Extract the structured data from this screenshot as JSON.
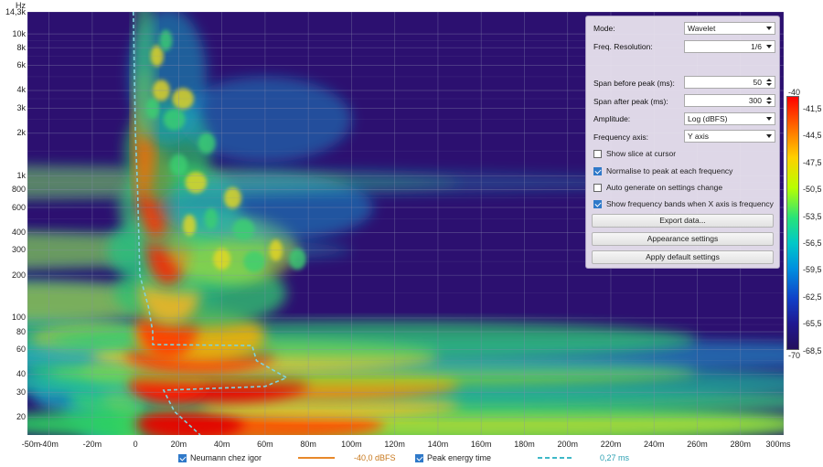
{
  "chart_data": {
    "type": "heatmap",
    "yunit": "Hz",
    "yticks": [
      "14,3k",
      "10k",
      "8k",
      "6k",
      "4k",
      "3k",
      "2k",
      "1k",
      "800",
      "600",
      "400",
      "300",
      "200",
      "100",
      "80",
      "60",
      "40",
      "30",
      "20"
    ],
    "xticks": [
      "-50m",
      "-40m",
      "-20m",
      "0",
      "20m",
      "40m",
      "60m",
      "80m",
      "100m",
      "120m",
      "140m",
      "160m",
      "180m",
      "200m",
      "220m",
      "240m",
      "260m",
      "280m",
      "300ms"
    ],
    "colorbar_ticks": [
      "-40",
      "-41,5",
      "-44,5",
      "-47,5",
      "-50,5",
      "-53,5",
      "-56,5",
      "-59,5",
      "-62,5",
      "-65,5",
      "-68,5",
      "-70"
    ],
    "xlim_ms": [
      -50,
      300
    ],
    "ylim_hz": [
      15,
      14300
    ],
    "yscale": "log",
    "zlim_dbfs": [
      -70,
      -40
    ],
    "peak_energy_curve": [
      {
        "t_ms": -1,
        "f_hz": 14300
      },
      {
        "t_ms": -0.5,
        "f_hz": 5000
      },
      {
        "t_ms": 0,
        "f_hz": 2000
      },
      {
        "t_ms": 1,
        "f_hz": 800
      },
      {
        "t_ms": 2,
        "f_hz": 200
      },
      {
        "t_ms": 6,
        "f_hz": 120
      },
      {
        "t_ms": 8,
        "f_hz": 80
      },
      {
        "t_ms": 8,
        "f_hz": 65
      },
      {
        "t_ms": 54,
        "f_hz": 64
      },
      {
        "t_ms": 56,
        "f_hz": 50
      },
      {
        "t_ms": 70,
        "f_hz": 38
      },
      {
        "t_ms": 60,
        "f_hz": 33
      },
      {
        "t_ms": 13,
        "f_hz": 31
      },
      {
        "t_ms": 18,
        "f_hz": 22
      },
      {
        "t_ms": 30,
        "f_hz": 15
      }
    ]
  },
  "panel": {
    "mode_label": "Mode:",
    "mode_value": "Wavelet",
    "freq_res_label": "Freq. Resolution:",
    "freq_res_value": "1/6",
    "span_before_label": "Span before peak (ms):",
    "span_before_value": "50",
    "span_after_label": "Span after peak (ms):",
    "span_after_value": "300",
    "amplitude_label": "Amplitude:",
    "amplitude_value": "Log (dBFS)",
    "freq_axis_label": "Frequency axis:",
    "freq_axis_value": "Y axis",
    "show_slice_label": "Show slice at cursor",
    "show_slice_checked": false,
    "normalise_label": "Normalise to peak at each frequency",
    "normalise_checked": true,
    "auto_generate_label": "Auto generate on settings change",
    "auto_generate_checked": false,
    "show_bands_label": "Show frequency bands when X axis is frequency",
    "show_bands_checked": true,
    "export_label": "Export data...",
    "appearance_label": "Appearance settings",
    "apply_defaults_label": "Apply default settings"
  },
  "legend": {
    "series1_name": "Neumann chez igor",
    "series1_value": "-40,0 dBFS",
    "series1_color": "#e8892a",
    "series2_name": "Peak energy time",
    "series2_value": "0,27 ms",
    "series2_color": "#3fb8c8"
  }
}
